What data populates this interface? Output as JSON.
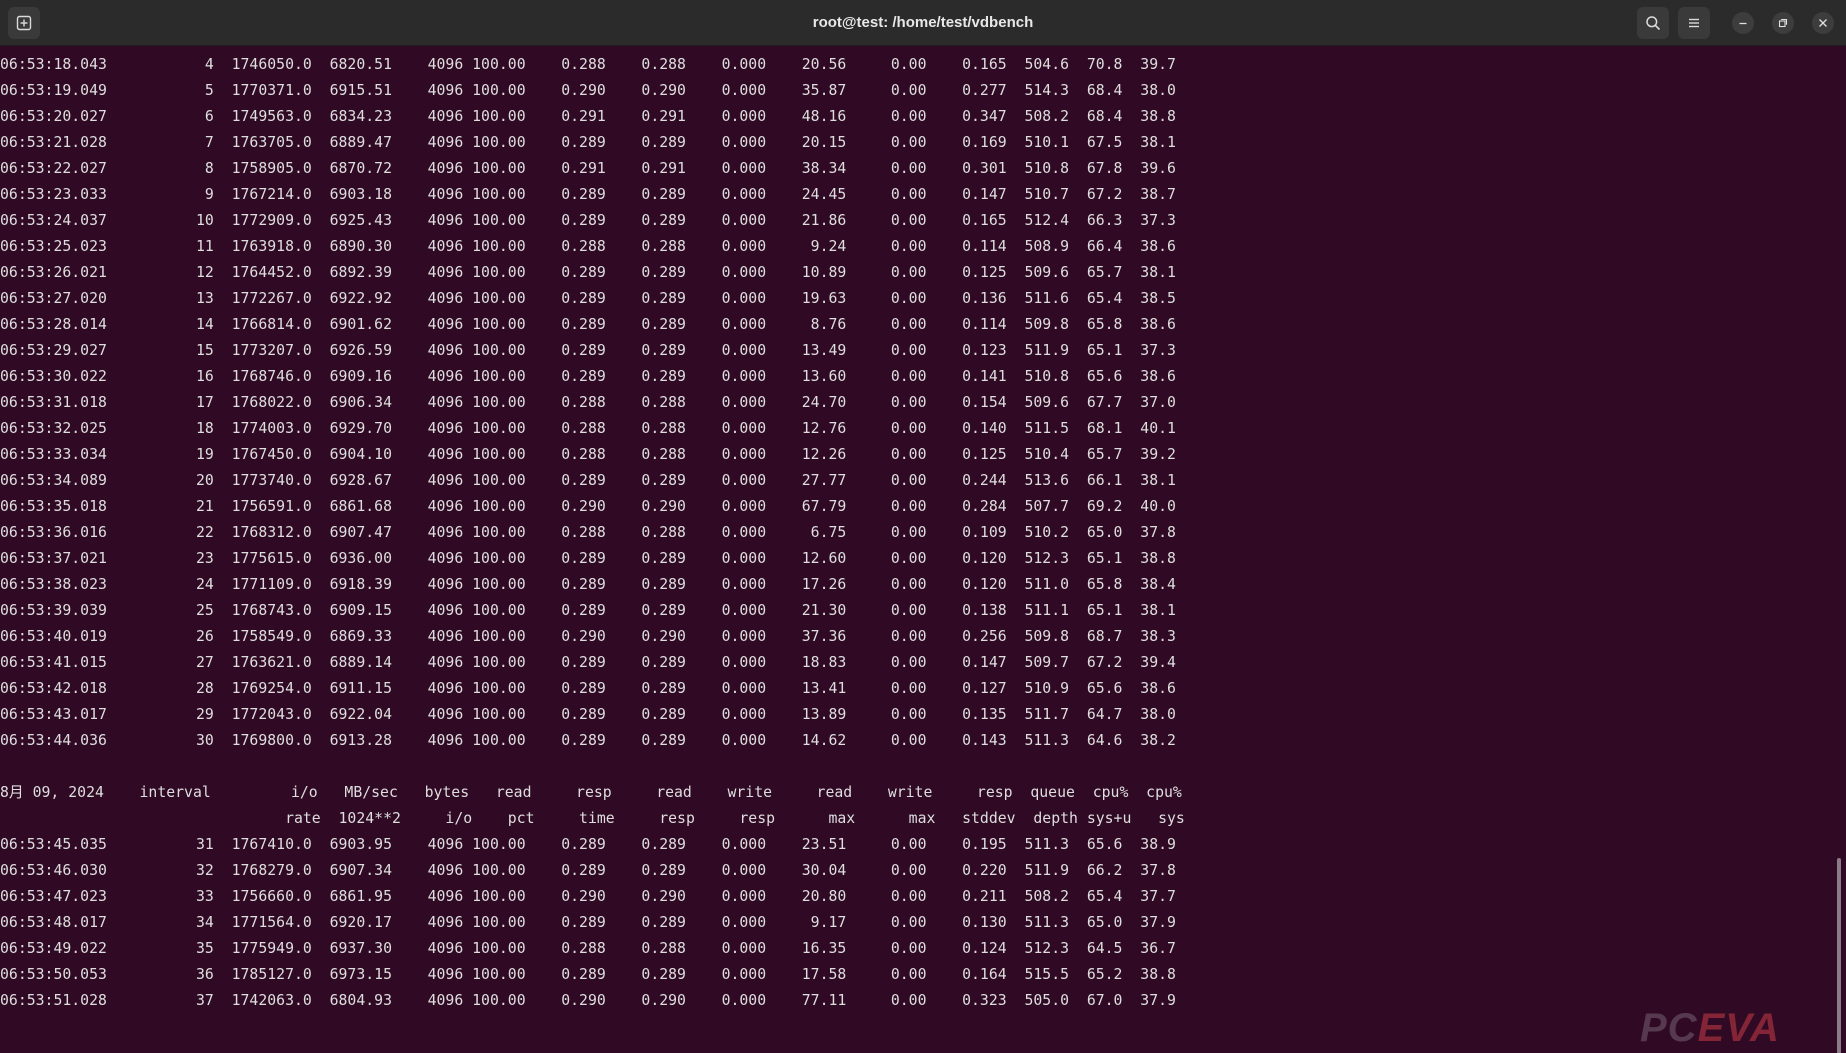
{
  "window": {
    "title": "root@test: /home/test/vdbench",
    "new_tab_icon": "new-tab-icon",
    "search_icon": "search-icon",
    "menu_icon": "hamburger-menu-icon",
    "minimize_icon": "minimize-icon",
    "restore_icon": "restore-icon",
    "close_icon": "close-icon"
  },
  "colors": {
    "terminal_bg": "#300a24",
    "titlebar_bg": "#2b2b2b",
    "text": "#dedede"
  },
  "terminal": {
    "lines": [
      "06:53:18.043           4  1746050.0  6820.51    4096 100.00    0.288    0.288    0.000    20.56     0.00    0.165  504.6  70.8  39.7",
      "06:53:19.049           5  1770371.0  6915.51    4096 100.00    0.290    0.290    0.000    35.87     0.00    0.277  514.3  68.4  38.0",
      "06:53:20.027           6  1749563.0  6834.23    4096 100.00    0.291    0.291    0.000    48.16     0.00    0.347  508.2  68.4  38.8",
      "06:53:21.028           7  1763705.0  6889.47    4096 100.00    0.289    0.289    0.000    20.15     0.00    0.169  510.1  67.5  38.1",
      "06:53:22.027           8  1758905.0  6870.72    4096 100.00    0.291    0.291    0.000    38.34     0.00    0.301  510.8  67.8  39.6",
      "06:53:23.033           9  1767214.0  6903.18    4096 100.00    0.289    0.289    0.000    24.45     0.00    0.147  510.7  67.2  38.7",
      "06:53:24.037          10  1772909.0  6925.43    4096 100.00    0.289    0.289    0.000    21.86     0.00    0.165  512.4  66.3  37.3",
      "06:53:25.023          11  1763918.0  6890.30    4096 100.00    0.288    0.288    0.000     9.24     0.00    0.114  508.9  66.4  38.6",
      "06:53:26.021          12  1764452.0  6892.39    4096 100.00    0.289    0.289    0.000    10.89     0.00    0.125  509.6  65.7  38.1",
      "06:53:27.020          13  1772267.0  6922.92    4096 100.00    0.289    0.289    0.000    19.63     0.00    0.136  511.6  65.4  38.5",
      "06:53:28.014          14  1766814.0  6901.62    4096 100.00    0.289    0.289    0.000     8.76     0.00    0.114  509.8  65.8  38.6",
      "06:53:29.027          15  1773207.0  6926.59    4096 100.00    0.289    0.289    0.000    13.49     0.00    0.123  511.9  65.1  37.3",
      "06:53:30.022          16  1768746.0  6909.16    4096 100.00    0.289    0.289    0.000    13.60     0.00    0.141  510.8  65.6  38.6",
      "06:53:31.018          17  1768022.0  6906.34    4096 100.00    0.288    0.288    0.000    24.70     0.00    0.154  509.6  67.7  37.0",
      "06:53:32.025          18  1774003.0  6929.70    4096 100.00    0.288    0.288    0.000    12.76     0.00    0.140  511.5  68.1  40.1",
      "06:53:33.034          19  1767450.0  6904.10    4096 100.00    0.288    0.288    0.000    12.26     0.00    0.125  510.4  65.7  39.2",
      "06:53:34.089          20  1773740.0  6928.67    4096 100.00    0.289    0.289    0.000    27.77     0.00    0.244  513.6  66.1  38.1",
      "06:53:35.018          21  1756591.0  6861.68    4096 100.00    0.290    0.290    0.000    67.79     0.00    0.284  507.7  69.2  40.0",
      "06:53:36.016          22  1768312.0  6907.47    4096 100.00    0.288    0.288    0.000     6.75     0.00    0.109  510.2  65.0  37.8",
      "06:53:37.021          23  1775615.0  6936.00    4096 100.00    0.289    0.289    0.000    12.60     0.00    0.120  512.3  65.1  38.8",
      "06:53:38.023          24  1771109.0  6918.39    4096 100.00    0.289    0.289    0.000    17.26     0.00    0.120  511.0  65.8  38.4",
      "06:53:39.039          25  1768743.0  6909.15    4096 100.00    0.289    0.289    0.000    21.30     0.00    0.138  511.1  65.1  38.1",
      "06:53:40.019          26  1758549.0  6869.33    4096 100.00    0.290    0.290    0.000    37.36     0.00    0.256  509.8  68.7  38.3",
      "06:53:41.015          27  1763621.0  6889.14    4096 100.00    0.289    0.289    0.000    18.83     0.00    0.147  509.7  67.2  39.4",
      "06:53:42.018          28  1769254.0  6911.15    4096 100.00    0.289    0.289    0.000    13.41     0.00    0.127  510.9  65.6  38.6",
      "06:53:43.017          29  1772043.0  6922.04    4096 100.00    0.289    0.289    0.000    13.89     0.00    0.135  511.7  64.7  38.0",
      "06:53:44.036          30  1769800.0  6913.28    4096 100.00    0.289    0.289    0.000    14.62     0.00    0.143  511.3  64.6  38.2",
      "",
      "8月 09, 2024    interval         i/o   MB/sec   bytes   read     resp     read    write     read    write     resp  queue  cpu%  cpu%",
      "                                rate  1024**2     i/o    pct     time     resp     resp      max      max   stddev  depth sys+u   sys",
      "06:53:45.035          31  1767410.0  6903.95    4096 100.00    0.289    0.289    0.000    23.51     0.00    0.195  511.3  65.6  38.9",
      "06:53:46.030          32  1768279.0  6907.34    4096 100.00    0.289    0.289    0.000    30.04     0.00    0.220  511.9  66.2  37.8",
      "06:53:47.023          33  1756660.0  6861.95    4096 100.00    0.290    0.290    0.000    20.80     0.00    0.211  508.2  65.4  37.7",
      "06:53:48.017          34  1771564.0  6920.17    4096 100.00    0.289    0.289    0.000     9.17     0.00    0.130  511.3  65.0  37.9",
      "06:53:49.022          35  1775949.0  6937.30    4096 100.00    0.288    0.288    0.000    16.35     0.00    0.124  512.3  64.5  36.7",
      "06:53:50.053          36  1785127.0  6973.15    4096 100.00    0.289    0.289    0.000    17.58     0.00    0.164  515.5  65.2  38.8",
      "06:53:51.028          37  1742063.0  6804.93    4096 100.00    0.290    0.290    0.000    77.11     0.00    0.323  505.0  67.0  37.9"
    ]
  },
  "watermark": {
    "prefix": "PC",
    "accent": "EVA"
  }
}
